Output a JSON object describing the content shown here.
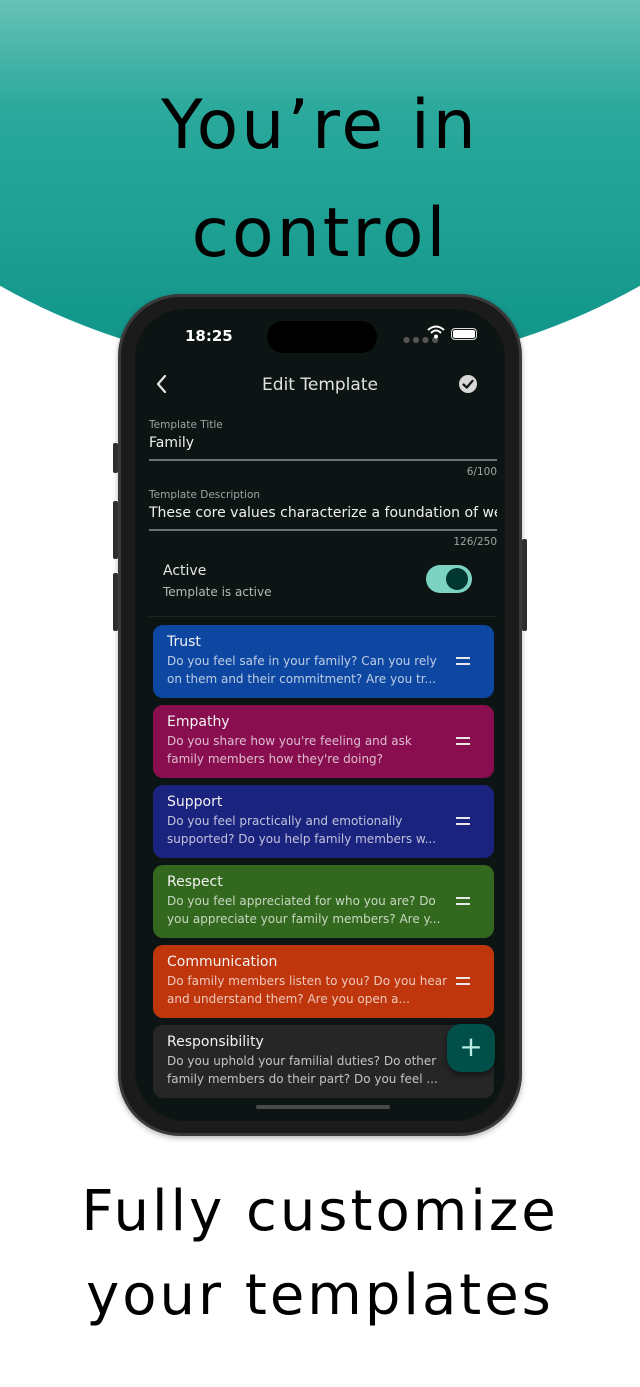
{
  "headline_top": [
    "You’re in",
    "control"
  ],
  "headline_bottom": [
    "Fully customize",
    "your templates"
  ],
  "status_bar": {
    "time": "18:25",
    "signal_icon": "signal-dots-icon",
    "wifi_icon": "wifi-icon",
    "battery_icon": "battery-icon"
  },
  "app_bar": {
    "title": "Edit Template",
    "back_icon": "chevron-left-icon",
    "save_icon": "check-circle-icon"
  },
  "form": {
    "title_field": {
      "label": "Template Title",
      "value": "Family",
      "counter": "6/100"
    },
    "description_field": {
      "label": "Template Description",
      "value": "These core values characterize a foundation of we",
      "counter": "126/250"
    },
    "active": {
      "label": "Active",
      "subtitle": "Template is active",
      "enabled": true
    }
  },
  "values": [
    {
      "title": "Trust",
      "description": "Do you feel safe in your family? Can you rely on them and their commitment? Are you tr...",
      "color": "#0d47a1"
    },
    {
      "title": "Empathy",
      "description": "Do you share how you're feeling and ask family members how they're doing?",
      "color": "#880e4f"
    },
    {
      "title": "Support",
      "description": "Do you feel practically and emotionally supported? Do you help family members w...",
      "color": "#1a237e"
    },
    {
      "title": "Respect",
      "description": "Do you feel appreciated for who you are? Do you appreciate your family members? Are y...",
      "color": "#33691e"
    },
    {
      "title": "Communication",
      "description": "Do family members listen to you? Do you hear and understand them? Are you open a...",
      "color": "#bf360c"
    },
    {
      "title": "Responsibility",
      "description": "Do you uphold your familial duties? Do other family members do their part? Do you feel ...",
      "color": "#262626"
    }
  ],
  "fab": {
    "label": "+",
    "icon": "plus-icon"
  },
  "colors": {
    "accent": "#7dd3c2",
    "background": "#0d1514",
    "teal_brand": "#0f9488"
  }
}
